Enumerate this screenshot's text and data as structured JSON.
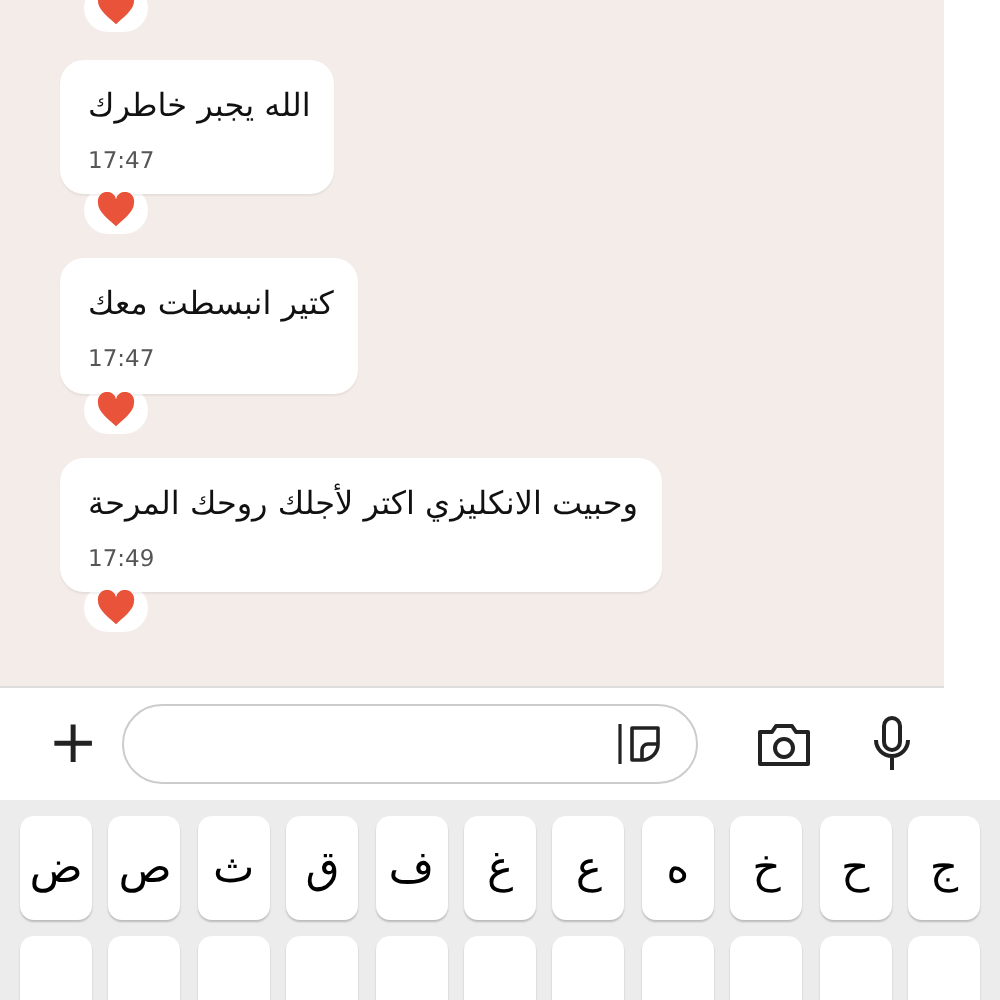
{
  "previous_message": {
    "reacted": true
  },
  "messages": [
    {
      "text": "الله يجبر خاطرك",
      "time": "17:47",
      "reacted": true
    },
    {
      "text": "كتير انبسطت معك",
      "time": "17:47",
      "reacted": true
    },
    {
      "text": "وحبيت الانكليزي اكتر لأجلك روحك المرحة",
      "time": "17:49",
      "reacted": true
    }
  ],
  "composer": {
    "plus": "+"
  },
  "keyboard": {
    "rows": [
      {
        "keys": [
          "ج",
          "ح",
          "خ",
          "ه",
          "ع",
          "غ",
          "ف",
          "ق",
          "ث",
          "ص",
          "ض"
        ]
      }
    ]
  }
}
